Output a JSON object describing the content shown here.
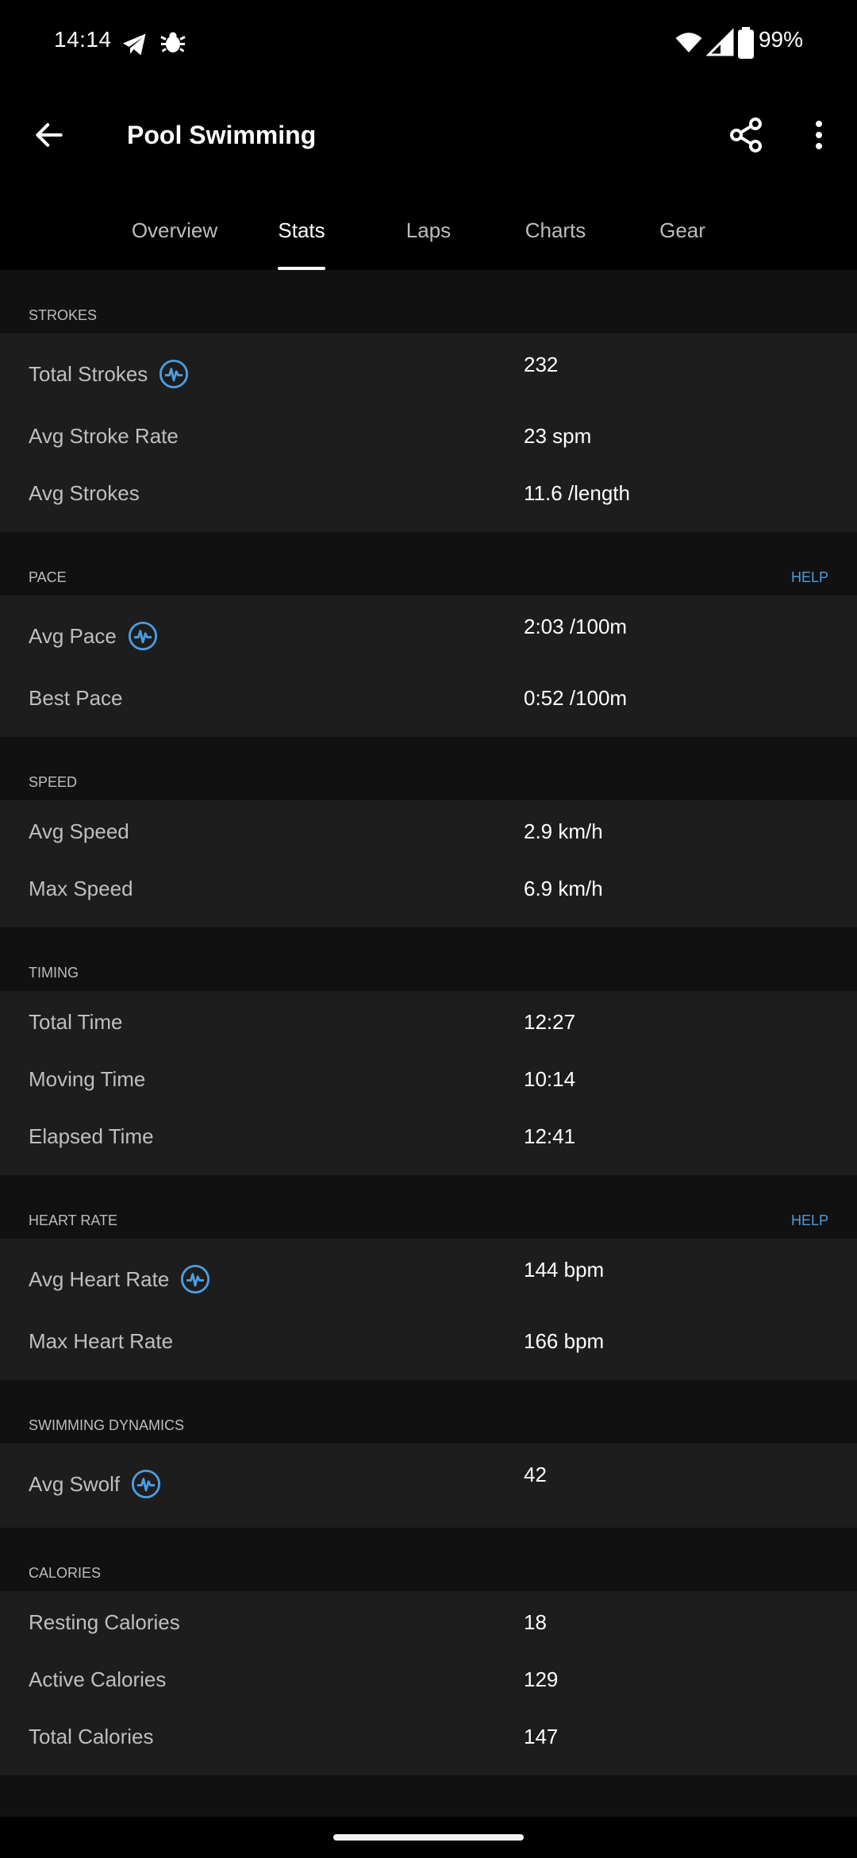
{
  "status": {
    "time": "14:14",
    "battery": "99%",
    "icons": [
      "telegram-icon",
      "bug-icon",
      "wifi-icon",
      "signal-icon",
      "battery-icon"
    ]
  },
  "appbar": {
    "title": "Pool Swimming",
    "back_icon": "arrow-left-icon",
    "share_icon": "share-icon",
    "more_icon": "more-vert-icon"
  },
  "tabs": [
    {
      "label": "Overview",
      "active": false
    },
    {
      "label": "Stats",
      "active": true
    },
    {
      "label": "Laps",
      "active": false
    },
    {
      "label": "Charts",
      "active": false
    },
    {
      "label": "Gear",
      "active": false
    }
  ],
  "sections": {
    "strokes": {
      "title": "STROKES",
      "rows": [
        {
          "label": "Total Strokes",
          "value": "232",
          "icon": "chart-pulse-icon"
        },
        {
          "label": "Avg Stroke Rate",
          "value": "23 spm"
        },
        {
          "label": "Avg Strokes",
          "value": "11.6 /length"
        }
      ]
    },
    "pace": {
      "title": "PACE",
      "help": "HELP",
      "rows": [
        {
          "label": "Avg Pace",
          "value": "2:03 /100m",
          "icon": "chart-pulse-icon"
        },
        {
          "label": "Best Pace",
          "value": "0:52 /100m"
        }
      ]
    },
    "speed": {
      "title": "SPEED",
      "rows": [
        {
          "label": "Avg Speed",
          "value": "2.9 km/h"
        },
        {
          "label": "Max Speed",
          "value": "6.9 km/h"
        }
      ]
    },
    "timing": {
      "title": "TIMING",
      "rows": [
        {
          "label": "Total Time",
          "value": "12:27"
        },
        {
          "label": "Moving Time",
          "value": "10:14"
        },
        {
          "label": "Elapsed Time",
          "value": "12:41"
        }
      ]
    },
    "heart_rate": {
      "title": "HEART RATE",
      "help": "HELP",
      "rows": [
        {
          "label": "Avg Heart Rate",
          "value": "144 bpm",
          "icon": "chart-pulse-icon"
        },
        {
          "label": "Max Heart Rate",
          "value": "166 bpm"
        }
      ]
    },
    "swimming_dynamics": {
      "title": "SWIMMING DYNAMICS",
      "rows": [
        {
          "label": "Avg Swolf",
          "value": "42",
          "icon": "chart-pulse-icon"
        }
      ]
    },
    "calories": {
      "title": "CALORIES",
      "rows": [
        {
          "label": "Resting Calories",
          "value": "18"
        },
        {
          "label": "Active Calories",
          "value": "129"
        },
        {
          "label": "Total Calories",
          "value": "147"
        }
      ]
    }
  },
  "colors": {
    "background": "#111111",
    "section_bg": "#1d1d1d",
    "accent": "#4d9de0",
    "text_primary": "#ffffff",
    "text_secondary": "#bfbfbf"
  }
}
